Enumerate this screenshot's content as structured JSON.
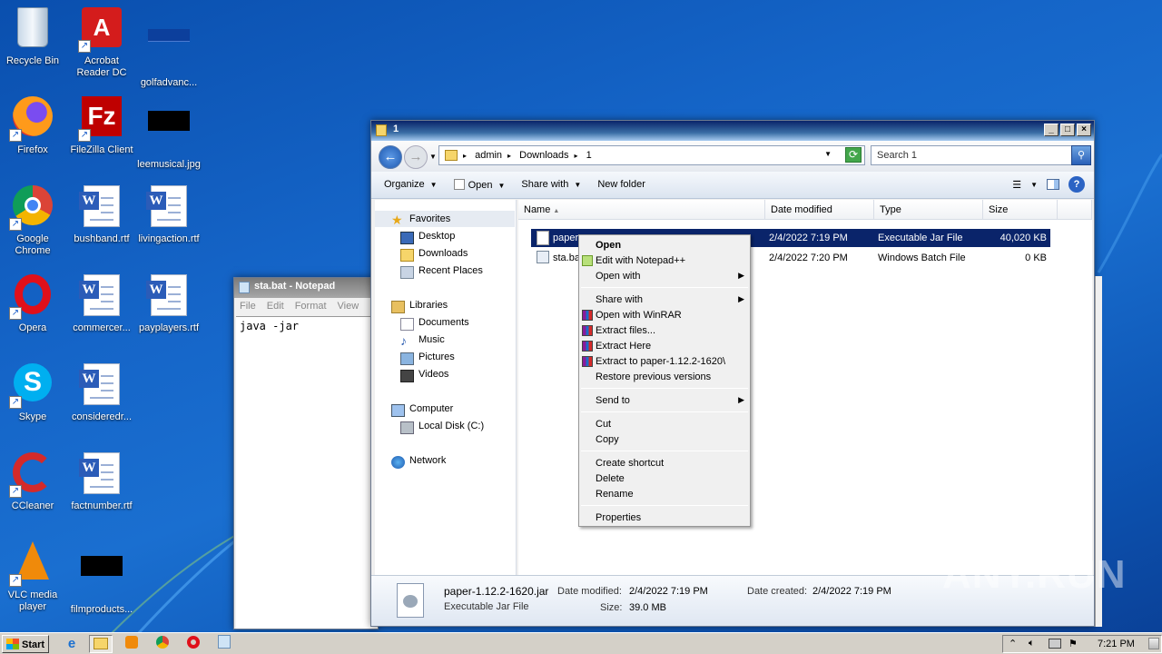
{
  "desktop": {
    "icons": [
      {
        "label": "Recycle Bin",
        "icon": "recycle-bin-icon"
      },
      {
        "label": "Acrobat Reader DC",
        "icon": "acrobat-icon"
      },
      {
        "label": "golfadvanc...",
        "icon": "file-icon"
      },
      {
        "label": "Firefox",
        "icon": "firefox-icon"
      },
      {
        "label": "FileZilla Client",
        "icon": "filezilla-icon"
      },
      {
        "label": "leemusical.jpg",
        "icon": "image-file-icon"
      },
      {
        "label": "Google Chrome",
        "icon": "chrome-icon"
      },
      {
        "label": "bushband.rtf",
        "icon": "word-doc-icon"
      },
      {
        "label": "livingaction.rtf",
        "icon": "word-doc-icon"
      },
      {
        "label": "Opera",
        "icon": "opera-icon"
      },
      {
        "label": "commercer...",
        "icon": "word-doc-icon"
      },
      {
        "label": "payplayers.rtf",
        "icon": "word-doc-icon"
      },
      {
        "label": "Skype",
        "icon": "skype-icon"
      },
      {
        "label": "consideredr...",
        "icon": "word-doc-icon"
      },
      {
        "label": "CCleaner",
        "icon": "ccleaner-icon"
      },
      {
        "label": "factnumber.rtf",
        "icon": "word-doc-icon"
      },
      {
        "label": "VLC media player",
        "icon": "vlc-icon"
      },
      {
        "label": "filmproducts...",
        "icon": "file-icon"
      }
    ]
  },
  "notepad": {
    "title": "sta.bat - Notepad",
    "menu": [
      "File",
      "Edit",
      "Format",
      "View",
      "H"
    ],
    "content": "java -jar"
  },
  "explorer": {
    "title": "1",
    "breadcrumb": [
      "admin",
      "Downloads",
      "1"
    ],
    "search_placeholder": "Search 1",
    "toolbar": {
      "organize": "Organize",
      "open": "Open",
      "share_with": "Share with",
      "new_folder": "New folder"
    },
    "nav": {
      "favorites": "Favorites",
      "desktop": "Desktop",
      "downloads": "Downloads",
      "recent": "Recent Places",
      "libraries": "Libraries",
      "documents": "Documents",
      "music": "Music",
      "pictures": "Pictures",
      "videos": "Videos",
      "computer": "Computer",
      "local_disk": "Local Disk (C:)",
      "network": "Network"
    },
    "columns": [
      "Name",
      "Date modified",
      "Type",
      "Size"
    ],
    "files": [
      {
        "name": "paper",
        "date": "2/4/2022 7:19 PM",
        "type": "Executable Jar File",
        "size": "40,020 KB",
        "selected": true
      },
      {
        "name": "sta.ba",
        "date": "2/4/2022 7:20 PM",
        "type": "Windows Batch File",
        "size": "0 KB",
        "selected": false
      }
    ],
    "details": {
      "filename": "paper-1.12.2-1620.jar",
      "filetype": "Executable Jar File",
      "modified_label": "Date modified:",
      "modified": "2/4/2022 7:19 PM",
      "created_label": "Date created:",
      "created": "2/4/2022 7:19 PM",
      "size_label": "Size:",
      "size": "39.0 MB"
    }
  },
  "context_menu": {
    "items": [
      {
        "label": "Open",
        "bold": true
      },
      {
        "label": "Edit with Notepad++",
        "icon": "notepadpp-icon"
      },
      {
        "label": "Open with",
        "submenu": true
      },
      {
        "sep": true
      },
      {
        "label": "Share with",
        "submenu": true
      },
      {
        "label": "Open with WinRAR",
        "icon": "winrar-icon"
      },
      {
        "label": "Extract files...",
        "icon": "winrar-icon"
      },
      {
        "label": "Extract Here",
        "icon": "winrar-icon"
      },
      {
        "label": "Extract to paper-1.12.2-1620\\",
        "icon": "winrar-icon"
      },
      {
        "label": "Restore previous versions"
      },
      {
        "sep": true
      },
      {
        "label": "Send to",
        "submenu": true
      },
      {
        "sep": true
      },
      {
        "label": "Cut"
      },
      {
        "label": "Copy"
      },
      {
        "sep": true
      },
      {
        "label": "Create shortcut"
      },
      {
        "label": "Delete"
      },
      {
        "label": "Rename"
      },
      {
        "sep": true
      },
      {
        "label": "Properties"
      }
    ]
  },
  "taskbar": {
    "start_label": "Start",
    "clock": "7:21 PM"
  },
  "watermark": "ANY.RUN"
}
